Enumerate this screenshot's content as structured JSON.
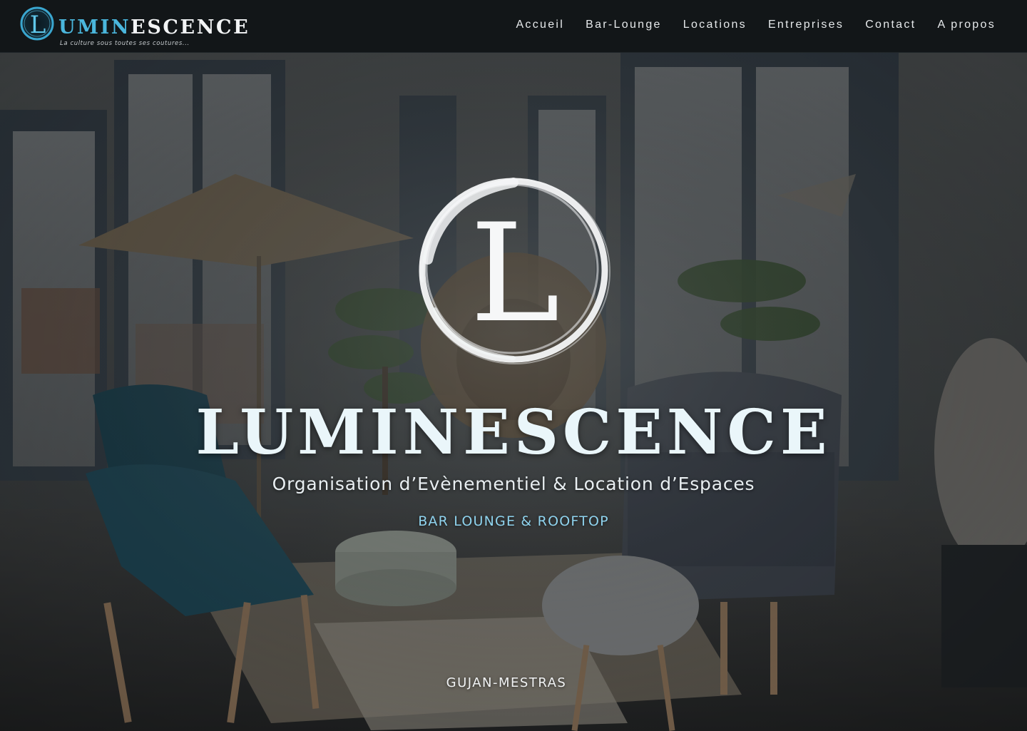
{
  "header": {
    "brand": {
      "logo_letter": "L",
      "name_accent": "UMIN",
      "name_rest": "ESCENCE",
      "tagline": "La culture sous toutes ses coutures..."
    },
    "nav": [
      {
        "label": "Accueil"
      },
      {
        "label": "Bar-Lounge"
      },
      {
        "label": "Locations"
      },
      {
        "label": "Entreprises"
      },
      {
        "label": "Contact"
      },
      {
        "label": "A propos"
      }
    ]
  },
  "hero": {
    "logo_letter": "L",
    "title": "LUMINESCENCE",
    "subtitle": "Organisation d’Evènementiel & Location d’Espaces",
    "tagline": "BAR LOUNGE & ROOFTOP",
    "location": "GUJAN-MESTRAS",
    "background_icon": "lounge-interior-photo"
  },
  "colors": {
    "header_bg": "#121618",
    "accent": "#4ab6dc",
    "tagline": "#8fd3ee",
    "text": "#eaf6fa"
  }
}
